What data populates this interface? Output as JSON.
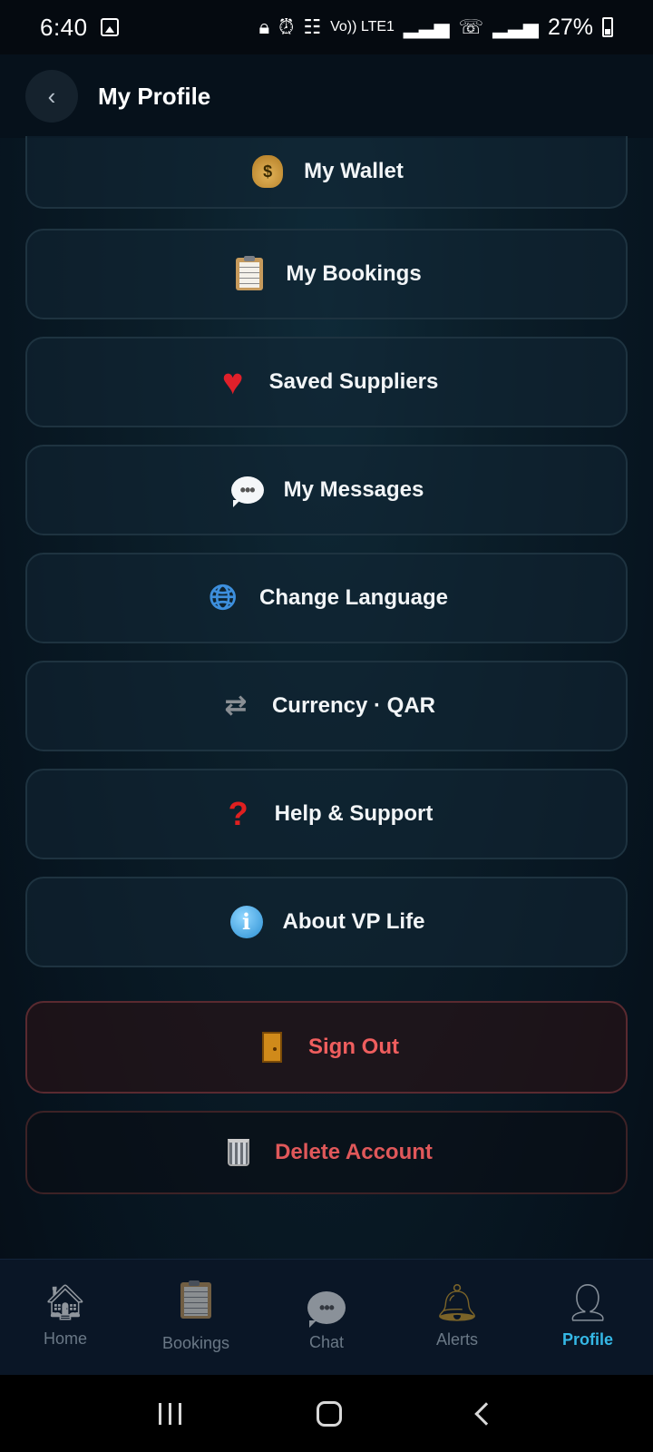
{
  "status_bar": {
    "time": "6:40",
    "signal_labels": [
      "Vo)) LTE1"
    ],
    "battery_percent": "27%"
  },
  "header": {
    "back_icon": "chevron-left-icon",
    "title": "My Profile"
  },
  "menu": [
    {
      "id": "wallet",
      "label": "My Wallet",
      "icon": "money-bag-icon"
    },
    {
      "id": "bookings",
      "label": "My Bookings",
      "icon": "clipboard-icon"
    },
    {
      "id": "saved-suppliers",
      "label": "Saved Suppliers",
      "icon": "heart-icon"
    },
    {
      "id": "messages",
      "label": "My Messages",
      "icon": "speech-bubble-icon"
    },
    {
      "id": "language",
      "label": "Change Language",
      "icon": "globe-icon"
    },
    {
      "id": "currency",
      "label": "Currency · QAR",
      "icon": "currency-exchange-icon"
    },
    {
      "id": "help",
      "label": "Help & Support",
      "icon": "question-mark-icon"
    },
    {
      "id": "about",
      "label": "About VP Life",
      "icon": "info-icon"
    }
  ],
  "account_actions": {
    "sign_out": {
      "label": "Sign Out",
      "icon": "door-icon",
      "color": "#ef5e5e"
    },
    "delete_account": {
      "label": "Delete Account",
      "icon": "wastebasket-icon",
      "color": "#e0585a"
    }
  },
  "bottom_nav": {
    "items": [
      {
        "label": "Home",
        "icon": "house-icon",
        "active": false
      },
      {
        "label": "Bookings",
        "icon": "clipboard-icon",
        "active": false
      },
      {
        "label": "Chat",
        "icon": "speech-bubble-icon",
        "active": false
      },
      {
        "label": "Alerts",
        "icon": "bell-icon",
        "active": false
      },
      {
        "label": "Profile",
        "icon": "user-silhouette-icon",
        "active": true
      }
    ],
    "active_color": "#35b8e6"
  }
}
